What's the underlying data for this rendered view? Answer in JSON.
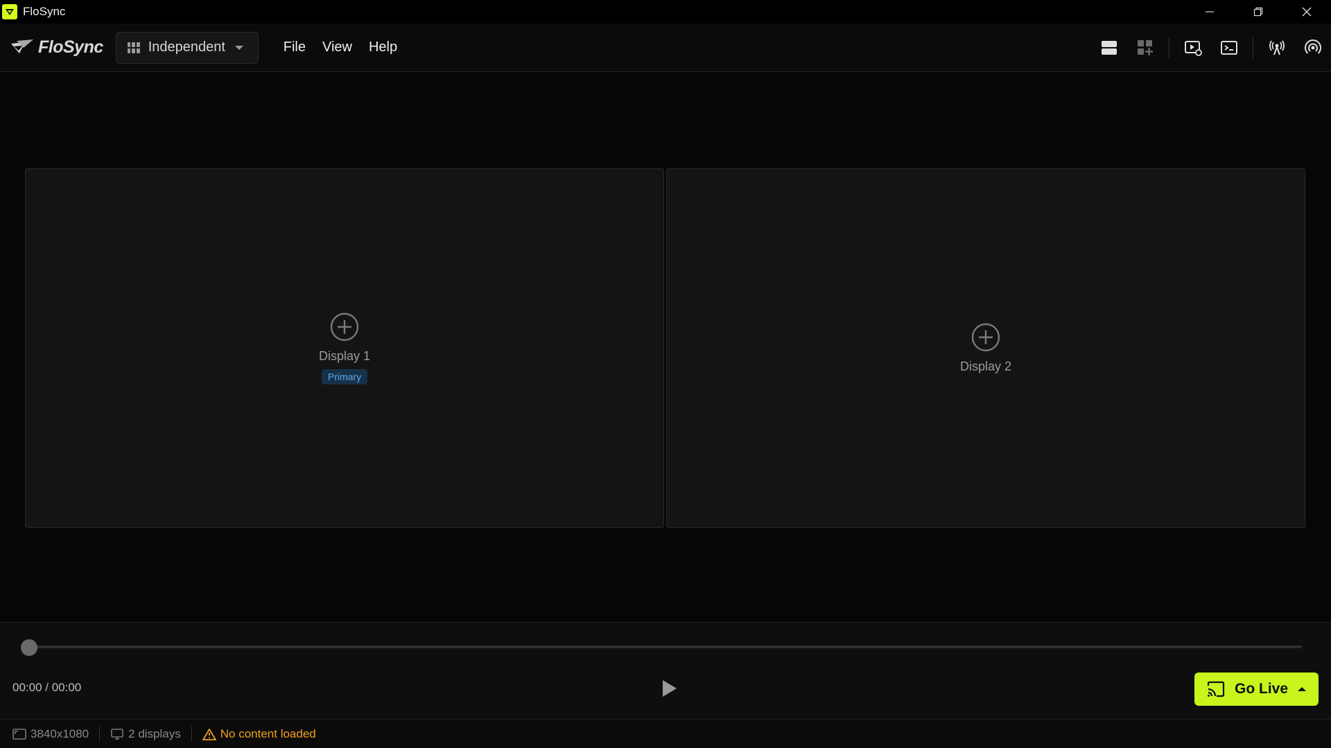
{
  "window": {
    "title": "FloSync"
  },
  "menubar": {
    "logo_text": "FloSync",
    "mode": "Independent",
    "menus": [
      "File",
      "View",
      "Help"
    ]
  },
  "toolbar": {
    "icons": [
      "layout-rows-icon",
      "add-widget-icon",
      "media-settings-icon",
      "terminal-icon",
      "broadcast-icon",
      "signal-icon"
    ]
  },
  "displays": [
    {
      "label": "Display 1",
      "badge": "Primary"
    },
    {
      "label": "Display 2"
    }
  ],
  "transport": {
    "time": "00:00 / 00:00",
    "progress": 0,
    "go_live_label": "Go Live"
  },
  "status": {
    "resolution": "3840x1080",
    "displays": "2 displays",
    "warning": "No content loaded"
  },
  "colors": {
    "accent": "#c8f51b",
    "badge_bg": "#16324a",
    "badge_text": "#5ea8e6",
    "warning": "#f0a020"
  }
}
